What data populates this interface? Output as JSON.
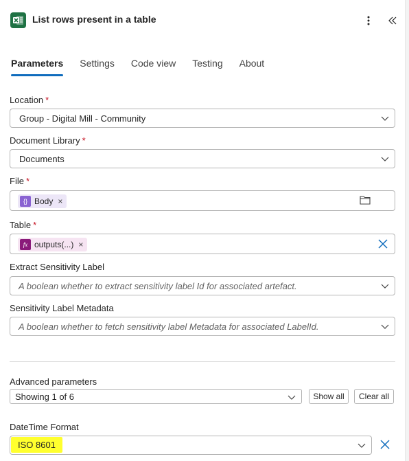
{
  "header": {
    "title": "List rows present in a table",
    "app_icon": "excel-icon",
    "more_icon": "more-vertical-icon",
    "collapse_icon": "double-chevron-left-icon"
  },
  "tabs": [
    {
      "label": "Parameters",
      "active": true
    },
    {
      "label": "Settings",
      "active": false
    },
    {
      "label": "Code view",
      "active": false
    },
    {
      "label": "Testing",
      "active": false
    },
    {
      "label": "About",
      "active": false
    }
  ],
  "fields": {
    "location": {
      "label": "Location",
      "required": "*",
      "value": "Group - Digital Mill - Community"
    },
    "document_library": {
      "label": "Document Library",
      "required": "*",
      "value": "Documents"
    },
    "file": {
      "label": "File",
      "required": "*",
      "token": {
        "icon_text": "{}",
        "label": "Body",
        "remove": "×"
      }
    },
    "table": {
      "label": "Table",
      "required": "*",
      "token": {
        "icon_text": "fx",
        "label": "outputs(...)",
        "remove": "×"
      }
    },
    "extract_sensitivity": {
      "label": "Extract Sensitivity Label",
      "placeholder": "A boolean whether to extract sensitivity label Id for associated artefact."
    },
    "sensitivity_metadata": {
      "label": "Sensitivity Label Metadata",
      "placeholder": "A boolean whether to fetch sensitivity label Metadata for associated LabelId."
    }
  },
  "advanced": {
    "label": "Advanced parameters",
    "value": "Showing 1 of 6",
    "show_all": "Show all",
    "clear_all": "Clear all"
  },
  "datetime": {
    "label": "DateTime Format",
    "value": "ISO 8601"
  },
  "colors": {
    "accent": "#0f6cbd",
    "required": "#c50f1f",
    "excel_green": "#1f7244",
    "token_purple": "#8a63d2",
    "expression_magenta": "#8a1a7a",
    "highlight": "#ffff2e"
  }
}
